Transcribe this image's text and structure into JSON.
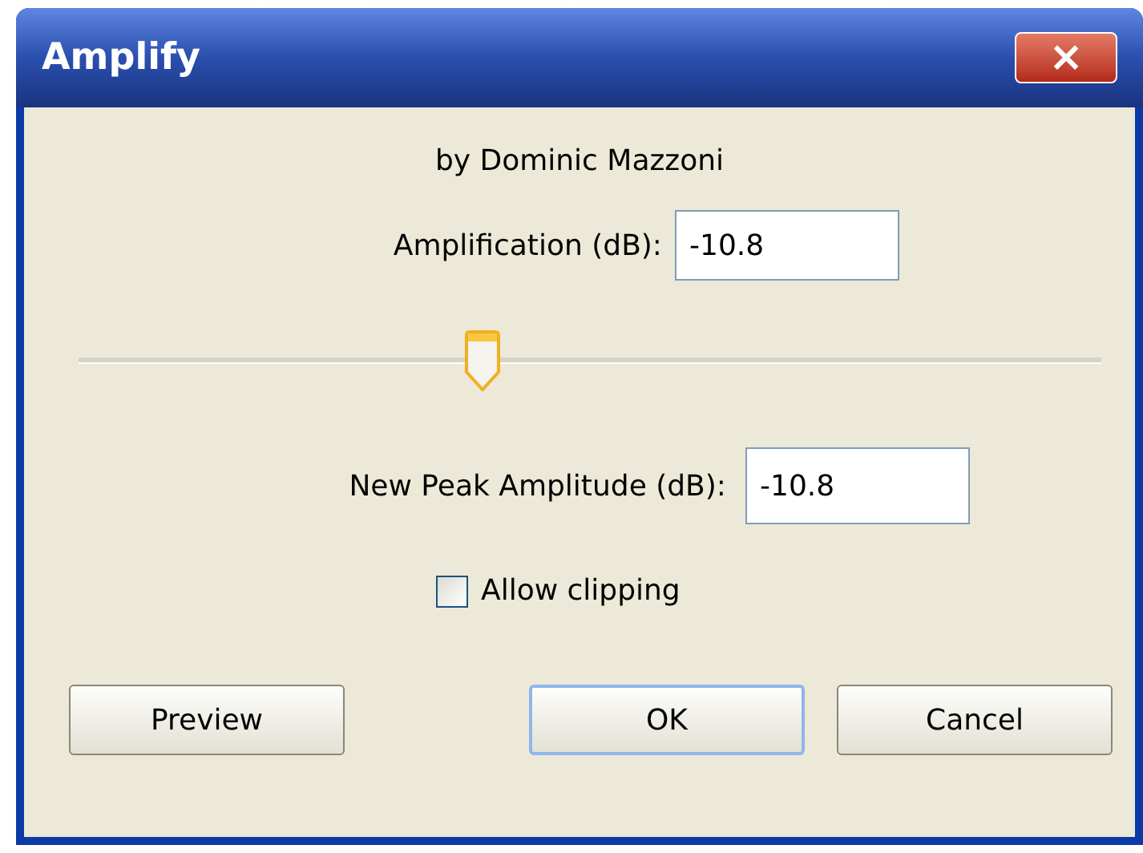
{
  "window": {
    "title": "Amplify",
    "close": "×"
  },
  "author": "by Dominic Mazzoni",
  "amplification": {
    "label": "Amplification (dB):",
    "value": "-10.8"
  },
  "slider": {
    "level": 0.395
  },
  "new_peak": {
    "label": "New Peak Amplitude (dB):",
    "value": "-10.8"
  },
  "allow_clipping": {
    "label": "Allow clipping",
    "checked": false
  },
  "buttons": [
    {
      "label": "Preview",
      "default": false
    },
    {
      "label": "OK",
      "default": true
    },
    {
      "label": "Cancel",
      "default": false
    }
  ]
}
